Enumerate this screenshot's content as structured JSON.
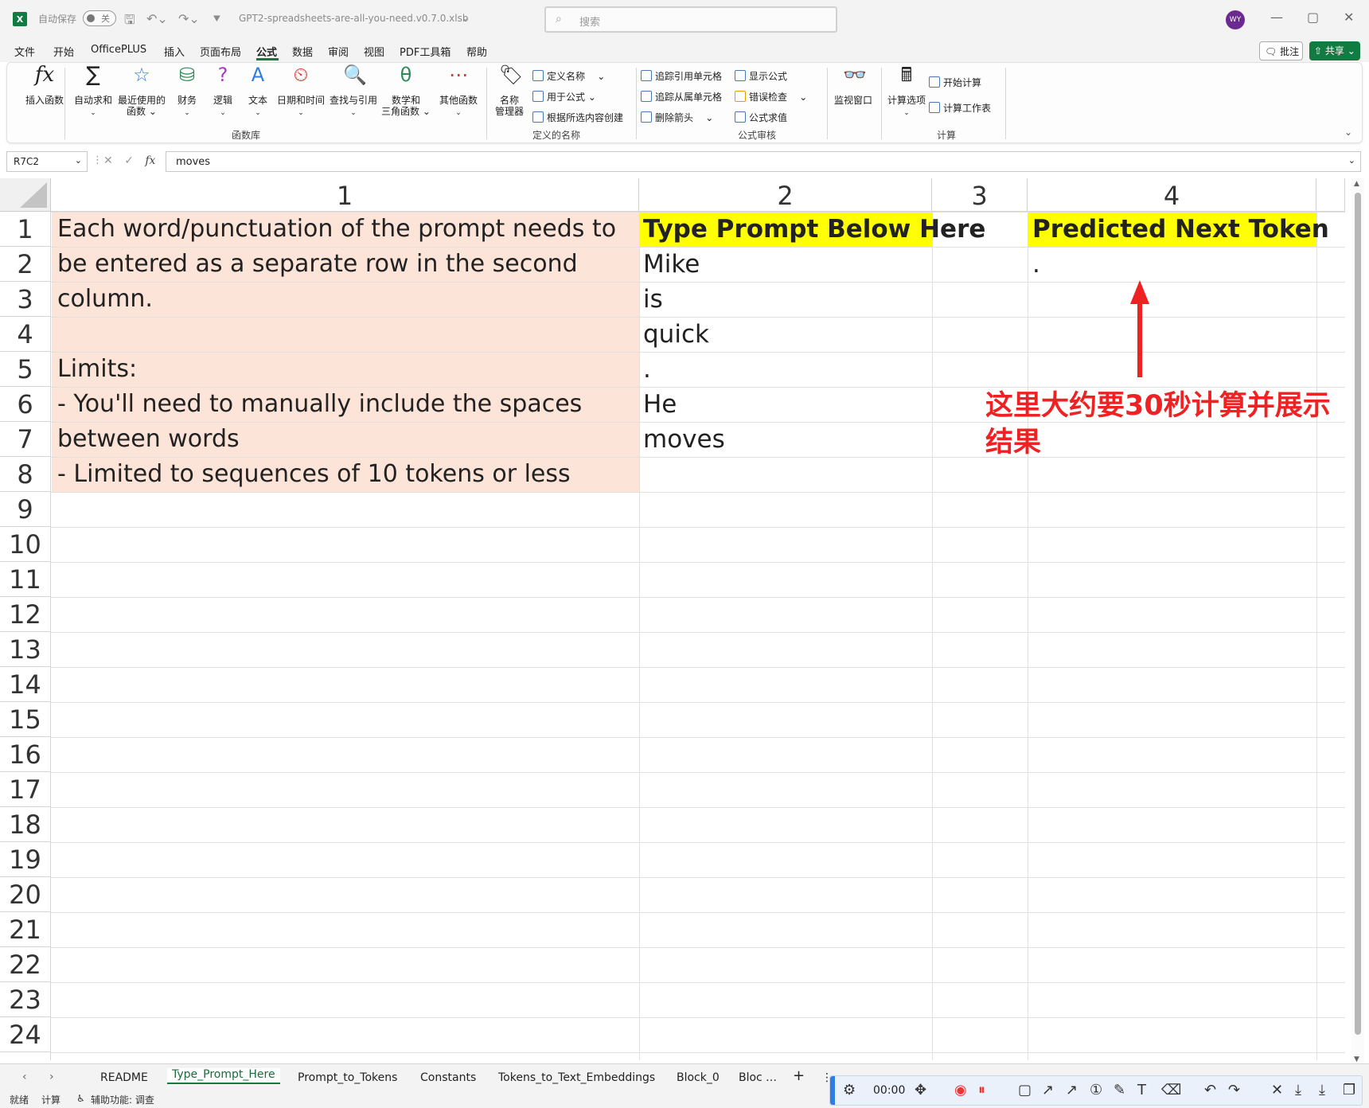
{
  "titlebar": {
    "autosave_label": "自动保存",
    "autosave_state": "关",
    "filename": "GPT2-spreadsheets-are-all-you-need.v0.7.0.xlsb",
    "search_placeholder": "搜索",
    "avatar_initials": "WY"
  },
  "menu": {
    "items": [
      "文件",
      "开始",
      "OfficePLUS",
      "插入",
      "页面布局",
      "公式",
      "数据",
      "审阅",
      "视图",
      "PDF工具箱",
      "帮助"
    ],
    "active": "公式",
    "comment_label": "批注",
    "share_label": "共享"
  },
  "ribbon": {
    "insert_function": "插入函数",
    "autosum": "自动求和",
    "recent_line1": "最近使用的",
    "recent_line2": "函数",
    "financial": "财务",
    "logical": "逻辑",
    "text": "文本",
    "datetime": "日期和时间",
    "lookup": "查找与引用",
    "math_line1": "数学和",
    "math_line2": "三角函数",
    "more": "其他函数",
    "group_library": "函数库",
    "name_manager_line1": "名称",
    "name_manager_line2": "管理器",
    "define_name": "定义名称",
    "use_in_formula": "用于公式",
    "create_from_selection": "根据所选内容创建",
    "group_names": "定义的名称",
    "trace_precedents": "追踪引用单元格",
    "trace_dependents": "追踪从属单元格",
    "remove_arrows": "删除箭头",
    "show_formulas": "显示公式",
    "error_checking": "错误检查",
    "evaluate_formula": "公式求值",
    "group_audit": "公式审核",
    "watch_window": "监视窗口",
    "calc_options": "计算选项",
    "calc_now": "开始计算",
    "calc_sheet": "计算工作表",
    "group_calc": "计算"
  },
  "formula_bar": {
    "name_box": "R7C2",
    "formula": "moves"
  },
  "grid": {
    "col_headers": [
      "1",
      "2",
      "3",
      "4"
    ],
    "row_headers": [
      "1",
      "2",
      "3",
      "4",
      "5",
      "6",
      "7",
      "8",
      "9",
      "10",
      "11",
      "12",
      "13",
      "14",
      "15",
      "16",
      "17",
      "18",
      "19",
      "20",
      "21",
      "22",
      "23",
      "24"
    ],
    "note_lines": [
      "Each word/punctuation of the prompt needs to",
      "be entered as a separate row in the second",
      "column.",
      "",
      "Limits:",
      "- You'll need to manually include the spaces",
      "between words",
      "- Limited to sequences of 10 tokens or less"
    ],
    "prompt_header": "Type Prompt Below Here",
    "prompt_tokens": [
      "Mike",
      "is",
      "quick",
      ".",
      "He",
      "moves"
    ],
    "predicted_header": "Predicted Next Token",
    "predicted_value": "."
  },
  "annotation": {
    "line1": "这里大约要30秒计算并展示",
    "line2": "结果",
    "color": "#ee2222"
  },
  "sheet_tabs": {
    "tabs": [
      "README",
      "Type_Prompt_Here",
      "Prompt_to_Tokens",
      "Constants",
      "Tokens_to_Text_Embeddings",
      "Block_0",
      "Bloc"
    ],
    "active": "Type_Prompt_Here"
  },
  "status": {
    "ready": "就绪",
    "calc": "计算",
    "accessibility": "辅助功能: 调查"
  },
  "recorder": {
    "time": "00:00"
  },
  "colors": {
    "excel_green": "#107c41",
    "note_fill": "#fde4d8",
    "header_fill": "#ffff00"
  }
}
